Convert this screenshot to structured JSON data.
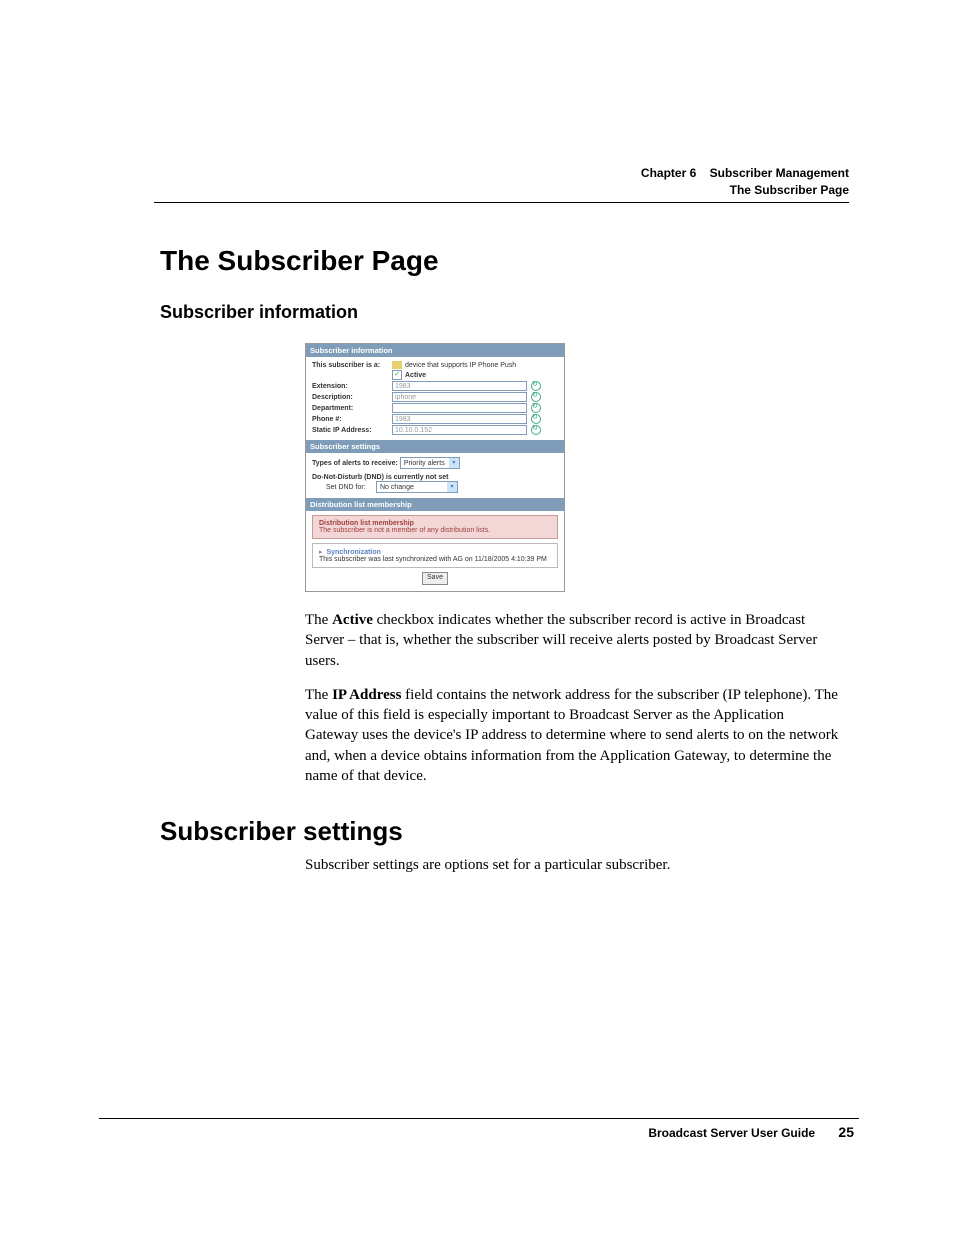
{
  "header": {
    "chapter": "Chapter 6",
    "chapter_title": "Subscriber Management",
    "section": "The Subscriber Page"
  },
  "h1_title": "The Subscriber Page",
  "h2_title": "Subscriber information",
  "panel": {
    "sec_info_header": "Subscriber information",
    "sub_is_a_label": "This subscriber is a:",
    "sub_is_a_value": "device that supports IP Phone Push",
    "active_label": "Active",
    "extension_label": "Extension:",
    "extension_value": "1983",
    "description_label": "Description:",
    "description_value": "iphone",
    "department_label": "Department:",
    "department_value": "",
    "phone_label": "Phone #:",
    "phone_value": "1983",
    "static_ip_label": "Static IP Address:",
    "static_ip_value": "10.10.0.152",
    "sec_settings_header": "Subscriber settings",
    "types_label": "Types of alerts to receive:",
    "types_value": "Priority alerts",
    "dnd_status": "Do-Not-Disturb (DND) is currently not set",
    "set_dnd_label": "Set DND for:",
    "set_dnd_value": "No change",
    "sec_dist_header": "Distribution list membership",
    "dist_title": "Distribution list membership",
    "dist_text": "The subscriber is not a member of any distribution lists.",
    "sync_title": "Synchronization",
    "sync_text": "This subscriber was last synchronized with AG on 11/18/2005 4:10:39 PM",
    "save_label": "Save"
  },
  "paragraphs": {
    "p1_pre": "The ",
    "p1_bold": "Active",
    "p1_post": " checkbox indicates whether the subscriber record is active in Broadcast Server – that is, whether the subscriber will receive alerts posted by Broadcast Server users.",
    "p2_pre": "The ",
    "p2_bold": "IP Address",
    "p2_post": " field contains the network address for the subscriber (IP telephone). The value of this field is especially important to Broadcast Server as the Application Gateway uses the device's IP address to determine where to send alerts to on the network and, when a device obtains information from the Application Gateway, to determine the name of that device."
  },
  "settings_h1": "Subscriber settings",
  "settings_p": "Subscriber settings are options set for a particular subscriber.",
  "footer": {
    "guide": "Broadcast Server User Guide",
    "page": "25"
  }
}
